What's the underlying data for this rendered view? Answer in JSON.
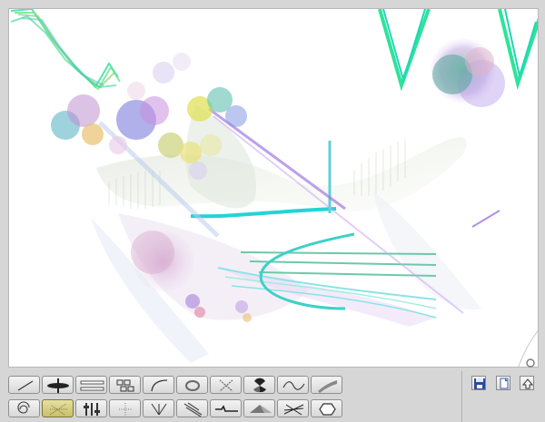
{
  "window": {
    "title": ""
  },
  "canvas": {
    "background": "#ffffff"
  },
  "toolbar": {
    "row1": [
      {
        "name": "line-tool-icon",
        "selected": false
      },
      {
        "name": "blade-tool-icon",
        "selected": false
      },
      {
        "name": "parallel-bars-tool-icon",
        "selected": false
      },
      {
        "name": "grid-blocks-tool-icon",
        "selected": false
      },
      {
        "name": "arc-tool-icon",
        "selected": false
      },
      {
        "name": "ring-tool-icon",
        "selected": false
      },
      {
        "name": "scatter-cross-tool-icon",
        "selected": false
      },
      {
        "name": "radiation-tool-icon",
        "selected": false
      },
      {
        "name": "wave-tool-icon",
        "selected": false
      },
      {
        "name": "ribbon-tool-icon",
        "selected": false
      }
    ],
    "row2": [
      {
        "name": "spiral-tool-icon",
        "selected": false
      },
      {
        "name": "sparkle-tool-icon",
        "selected": true
      },
      {
        "name": "sliders-tool-icon",
        "selected": false
      },
      {
        "name": "cross-dots-tool-icon",
        "selected": false
      },
      {
        "name": "fan-tool-icon",
        "selected": false
      },
      {
        "name": "brush-strokes-tool-icon",
        "selected": false
      },
      {
        "name": "step-line-tool-icon",
        "selected": false
      },
      {
        "name": "prism-tool-icon",
        "selected": false
      },
      {
        "name": "hatch-tool-icon",
        "selected": false
      },
      {
        "name": "hexagon-tool-icon",
        "selected": false
      }
    ]
  },
  "file_actions": [
    {
      "name": "save-icon"
    },
    {
      "name": "new-page-icon"
    },
    {
      "name": "upload-icon"
    }
  ],
  "colors": {
    "accent_selected": "#c8bf6a",
    "stroke_cyan": "#22d4d6",
    "stroke_green": "#33dd88",
    "stroke_purple": "#a079e0"
  }
}
